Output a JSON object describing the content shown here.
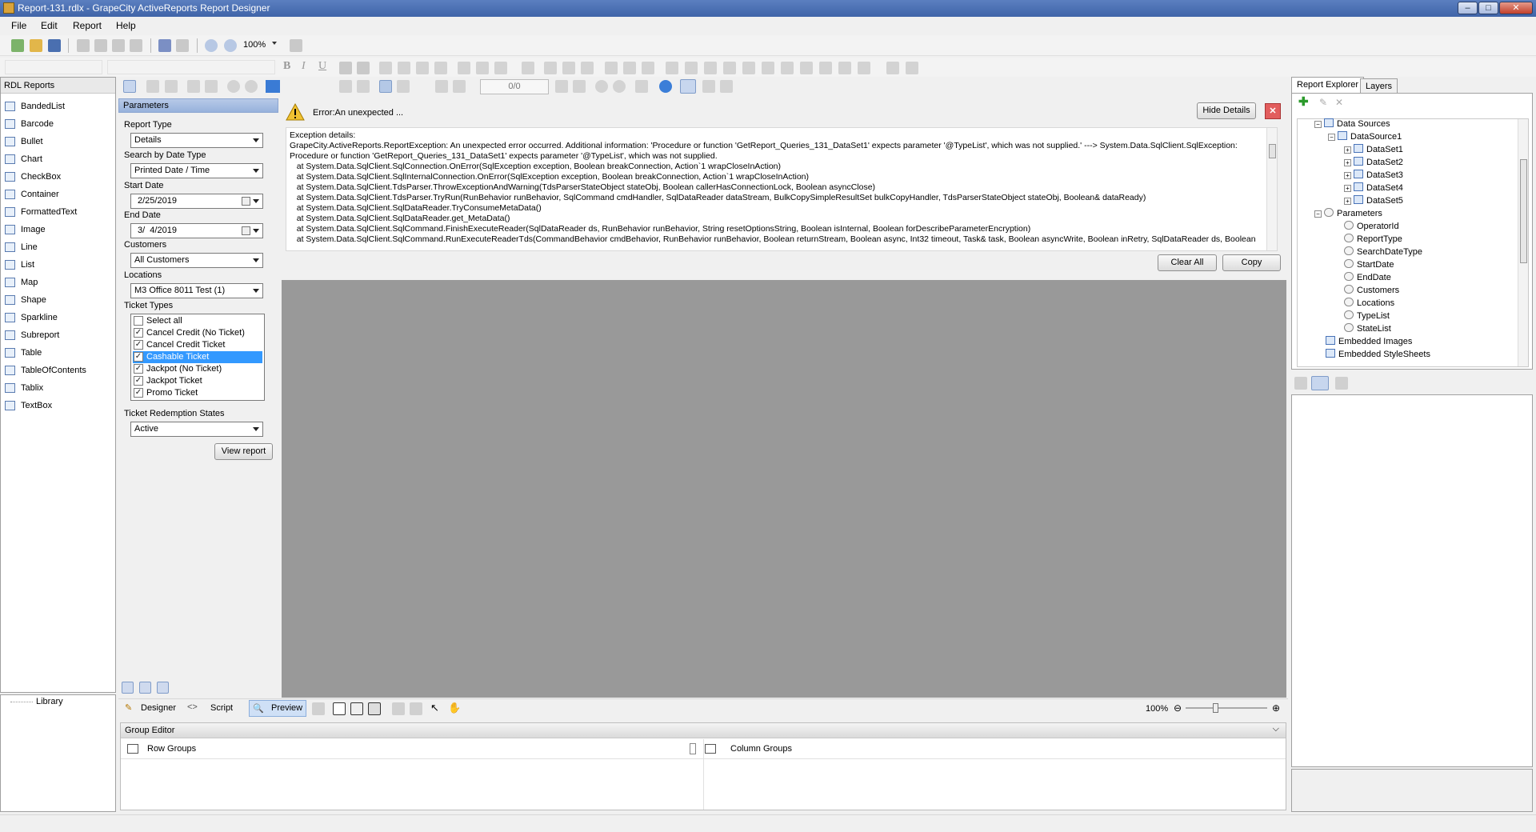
{
  "window": {
    "title": "Report-131.rdlx - GrapeCity ActiveReports Report Designer"
  },
  "menu": {
    "file": "File",
    "edit": "Edit",
    "report": "Report",
    "help": "Help"
  },
  "toolbar": {
    "zoom": "100%",
    "page_counter": "0/0"
  },
  "toolbox": {
    "header": "RDL Reports",
    "items": [
      "BandedList",
      "Barcode",
      "Bullet",
      "Chart",
      "CheckBox",
      "Container",
      "FormattedText",
      "Image",
      "Line",
      "List",
      "Map",
      "Shape",
      "Sparkline",
      "Subreport",
      "Table",
      "TableOfContents",
      "Tablix",
      "TextBox"
    ],
    "library_label": "Library"
  },
  "parameters": {
    "header": "Parameters",
    "report_type_label": "Report Type",
    "report_type_value": "Details",
    "search_by_label": "Search by Date Type",
    "search_by_value": "Printed Date / Time",
    "start_date_label": "Start Date",
    "start_date_value": "2/25/2019",
    "end_date_label": "End Date",
    "end_date_value": "3/  4/2019",
    "customers_label": "Customers",
    "customers_value": "All Customers",
    "locations_label": "Locations",
    "locations_value": "M3 Office 8011 Test (1)",
    "ticket_types_label": "Ticket Types",
    "ticket_types": [
      {
        "label": "Select all",
        "checked": false
      },
      {
        "label": "Cancel Credit (No Ticket)",
        "checked": true
      },
      {
        "label": "Cancel Credit Ticket",
        "checked": true
      },
      {
        "label": "Cashable Ticket",
        "checked": true
      },
      {
        "label": "Jackpot (No Ticket)",
        "checked": true
      },
      {
        "label": "Jackpot Ticket",
        "checked": true
      },
      {
        "label": "Promo Ticket",
        "checked": true
      }
    ],
    "redemption_label": "Ticket Redemption States",
    "redemption_value": "Active",
    "view_report_button": "View report"
  },
  "error": {
    "message": "Error:An unexpected ...",
    "hide_details_button": "Hide Details",
    "details": "Exception details:\nGrapeCity.ActiveReports.ReportException: An unexpected error occurred. Additional information: 'Procedure or function 'GetReport_Queries_131_DataSet1' expects parameter '@TypeList', which was not supplied.' ---> System.Data.SqlClient.SqlException:\nProcedure or function 'GetReport_Queries_131_DataSet1' expects parameter '@TypeList', which was not supplied.\n   at System.Data.SqlClient.SqlConnection.OnError(SqlException exception, Boolean breakConnection, Action`1 wrapCloseInAction)\n   at System.Data.SqlClient.SqlInternalConnection.OnError(SqlException exception, Boolean breakConnection, Action`1 wrapCloseInAction)\n   at System.Data.SqlClient.TdsParser.ThrowExceptionAndWarning(TdsParserStateObject stateObj, Boolean callerHasConnectionLock, Boolean asyncClose)\n   at System.Data.SqlClient.TdsParser.TryRun(RunBehavior runBehavior, SqlCommand cmdHandler, SqlDataReader dataStream, BulkCopySimpleResultSet bulkCopyHandler, TdsParserStateObject stateObj, Boolean& dataReady)\n   at System.Data.SqlClient.SqlDataReader.TryConsumeMetaData()\n   at System.Data.SqlClient.SqlDataReader.get_MetaData()\n   at System.Data.SqlClient.SqlCommand.FinishExecuteReader(SqlDataReader ds, RunBehavior runBehavior, String resetOptionsString, Boolean isInternal, Boolean forDescribeParameterEncryption)\n   at System.Data.SqlClient.SqlCommand.RunExecuteReaderTds(CommandBehavior cmdBehavior, RunBehavior runBehavior, Boolean returnStream, Boolean async, Int32 timeout, Task& task, Boolean asyncWrite, Boolean inRetry, SqlDataReader ds, Boolean",
    "clear_all_button": "Clear All",
    "copy_button": "Copy"
  },
  "bottom_tabs": {
    "designer": "Designer",
    "script": "Script",
    "preview": "Preview",
    "zoom": "100%"
  },
  "group_editor": {
    "header": "Group Editor",
    "row_groups": "Row Groups",
    "column_groups": "Column Groups"
  },
  "explorer": {
    "tab_report_explorer": "Report Explorer",
    "tab_layers": "Layers",
    "data_sources": "Data Sources",
    "datasource1": "DataSource1",
    "datasets": [
      "DataSet1",
      "DataSet2",
      "DataSet3",
      "DataSet4",
      "DataSet5"
    ],
    "parameters": "Parameters",
    "parameter_items": [
      "OperatorId",
      "ReportType",
      "SearchDateType",
      "StartDate",
      "EndDate",
      "Customers",
      "Locations",
      "TypeList",
      "StateList"
    ],
    "embedded_images": "Embedded Images",
    "embedded_stylesheets": "Embedded StyleSheets"
  }
}
